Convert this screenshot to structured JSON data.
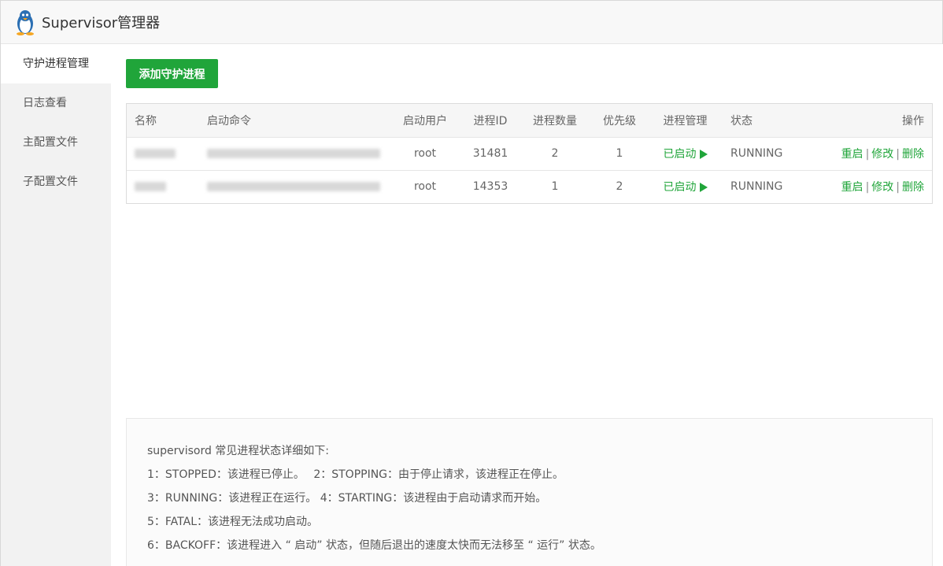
{
  "app": {
    "title": "Supervisor管理器",
    "logo_icon": "penguin-icon"
  },
  "sidebar": {
    "items": [
      {
        "label": "守护进程管理",
        "active": true
      },
      {
        "label": "日志查看",
        "active": false
      },
      {
        "label": "主配置文件",
        "active": false
      },
      {
        "label": "子配置文件",
        "active": false
      }
    ]
  },
  "toolbar": {
    "add_label": "添加守护进程"
  },
  "table": {
    "headers": {
      "name": "名称",
      "command": "启动命令",
      "user": "启动用户",
      "pid": "进程ID",
      "count": "进程数量",
      "priority": "优先级",
      "manage": "进程管理",
      "status": "状态",
      "ops": "操作"
    },
    "rows": [
      {
        "user": "root",
        "pid": "31481",
        "count": "2",
        "priority": "1",
        "manage": "已启动",
        "status": "RUNNING",
        "op_restart": "重启",
        "op_edit": "修改",
        "op_delete": "删除"
      },
      {
        "user": "root",
        "pid": "14353",
        "count": "1",
        "priority": "2",
        "manage": "已启动",
        "status": "RUNNING",
        "op_restart": "重启",
        "op_edit": "修改",
        "op_delete": "删除"
      }
    ],
    "separator": "|"
  },
  "info": {
    "lines": [
      "supervisord 常见进程状态详细如下:",
      "1：STOPPED：该进程已停止。　 2：STOPPING：由于停止请求，该进程正在停止。",
      "3：RUNNING：该进程正在运行。 4：STARTING：该进程由于启动请求而开始。",
      "5：FATAL：该进程无法成功启动。",
      "6：BACKOFF：该进程进入 “ 启动” 状态，但随后退出的速度太快而无法移至 “ 运行” 状态。"
    ]
  },
  "colors": {
    "accent": "#20a53a"
  }
}
